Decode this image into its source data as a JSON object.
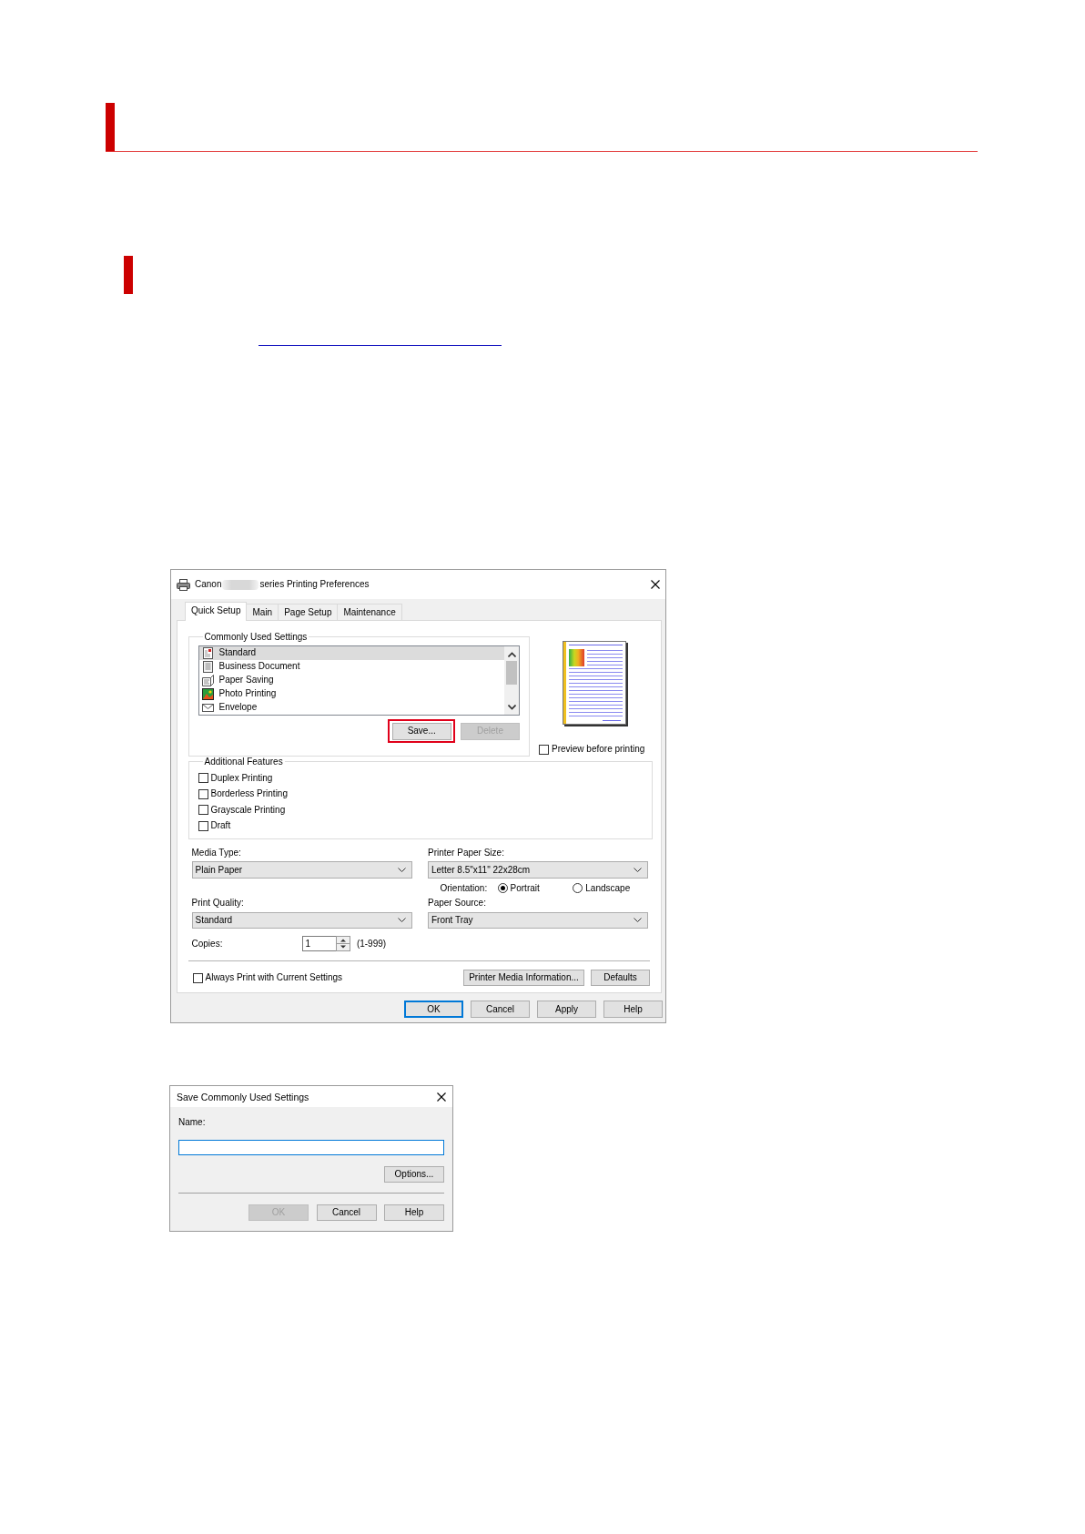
{
  "preferences_dialog": {
    "title_start": "Canon",
    "title_end": "series Printing Preferences",
    "tabs": [
      {
        "label": "Quick Setup",
        "selected": true
      },
      {
        "label": "Main",
        "selected": false
      },
      {
        "label": "Page Setup",
        "selected": false
      },
      {
        "label": "Maintenance",
        "selected": false
      }
    ],
    "commonly_used_settings": {
      "label": "Commonly Used Settings",
      "items": [
        {
          "kind": "standard",
          "label": "Standard",
          "selected": true
        },
        {
          "kind": "document",
          "label": "Business Document",
          "selected": false
        },
        {
          "kind": "saving",
          "label": "Paper Saving",
          "selected": false
        },
        {
          "kind": "photo",
          "label": "Photo Printing",
          "selected": false
        },
        {
          "kind": "envelope",
          "label": "Envelope",
          "selected": false
        }
      ],
      "buttons": [
        {
          "label": "Save...",
          "highlighted": true,
          "disabled": false
        },
        {
          "label": "Delete",
          "highlighted": false,
          "disabled": true
        }
      ]
    },
    "preview_before_printing": {
      "label": "Preview before printing",
      "checked": false
    },
    "additional_features": {
      "label": "Additional Features",
      "items": [
        {
          "label": "Duplex Printing",
          "checked": false
        },
        {
          "label": "Borderless Printing",
          "checked": false
        },
        {
          "label": "Grayscale Printing",
          "checked": false
        },
        {
          "label": "Draft",
          "checked": false
        }
      ]
    },
    "media_type": {
      "label": "Media Type:",
      "value": "Plain Paper"
    },
    "printer_paper_size": {
      "label": "Printer Paper Size:",
      "value": "Letter 8.5\"x11\" 22x28cm"
    },
    "orientation": {
      "label": "Orientation:",
      "options": [
        {
          "label": "Portrait",
          "selected": true
        },
        {
          "label": "Landscape",
          "selected": false
        }
      ]
    },
    "print_quality": {
      "label": "Print Quality:",
      "value": "Standard"
    },
    "paper_source": {
      "label": "Paper Source:",
      "value": "Front Tray"
    },
    "copies": {
      "label": "Copies:",
      "value": "1",
      "range": "(1-999)"
    },
    "always_print": {
      "label": "Always Print with Current Settings",
      "checked": false
    },
    "panel_buttons": [
      "Printer Media Information...",
      "Defaults"
    ],
    "footer_buttons": [
      {
        "label": "OK",
        "default": true
      },
      {
        "label": "Cancel",
        "default": false
      },
      {
        "label": "Apply",
        "default": false
      },
      {
        "label": "Help",
        "default": false
      }
    ]
  },
  "save_dialog": {
    "title": "Save Commonly Used Settings",
    "name_field": {
      "label": "Name:",
      "focused": true
    },
    "options_button": "Options...",
    "buttons": [
      {
        "label": "OK",
        "disabled": true
      },
      {
        "label": "Cancel",
        "disabled": false
      },
      {
        "label": "Help",
        "disabled": false
      }
    ]
  }
}
